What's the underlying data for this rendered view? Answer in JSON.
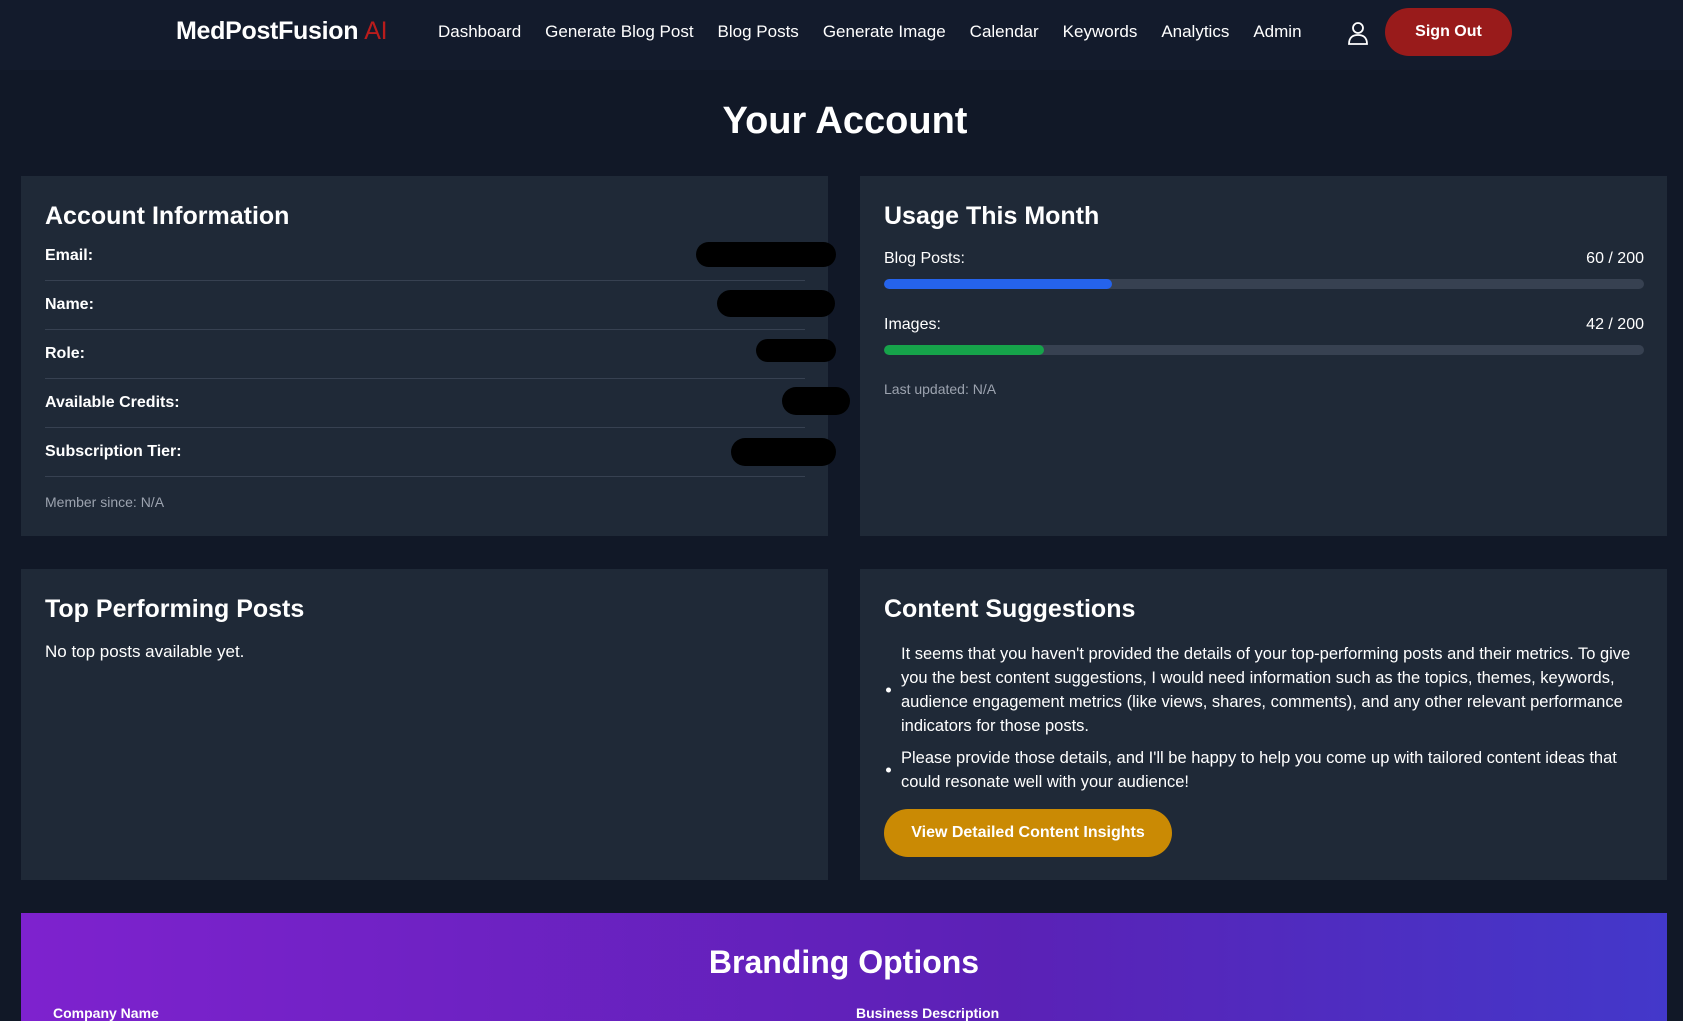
{
  "brand": {
    "name": "MedPostFusion",
    "suffix": "AI"
  },
  "nav": {
    "links": [
      "Dashboard",
      "Generate Blog Post",
      "Blog Posts",
      "Generate Image",
      "Calendar",
      "Keywords",
      "Analytics",
      "Admin"
    ],
    "user_icon": "user-icon",
    "sign_out": "Sign Out"
  },
  "page": {
    "title": "Your Account"
  },
  "account": {
    "title": "Account Information",
    "fields": [
      {
        "label": "Email:"
      },
      {
        "label": "Name:"
      },
      {
        "label": "Role:"
      },
      {
        "label": "Available Credits:"
      },
      {
        "label": "Subscription Tier:"
      }
    ],
    "member_since": "Member since: N/A"
  },
  "usage": {
    "title": "Usage This Month",
    "items": [
      {
        "label": "Blog Posts:",
        "count": "60 / 200",
        "used": 60,
        "limit": 200,
        "color": "#2563eb"
      },
      {
        "label": "Images:",
        "count": "42 / 200",
        "used": 42,
        "limit": 200,
        "color": "#16a34a"
      }
    ],
    "last_updated": "Last updated: N/A"
  },
  "top_posts": {
    "title": "Top Performing Posts",
    "empty": "No top posts available yet."
  },
  "suggestions": {
    "title": "Content Suggestions",
    "items": [
      "It seems that you haven't provided the details of your top-performing posts and their metrics. To give you the best content suggestions, I would need information such as the topics, themes, keywords, audience engagement metrics (like views, shares, comments), and any other relevant performance indicators for those posts.",
      "Please provide those details, and I'll be happy to help you come up with tailored content ideas that could resonate well with your audience!"
    ],
    "button": "View Detailed Content Insights"
  },
  "branding": {
    "title": "Branding Options",
    "company_label": "Company Name",
    "description_label": "Business Description"
  },
  "colors": {
    "background": "#111827",
    "card": "#1f2937",
    "sign_out": "#991b1b",
    "accent_ai": "#b91c1c",
    "insights_button": "#ca8a04"
  }
}
